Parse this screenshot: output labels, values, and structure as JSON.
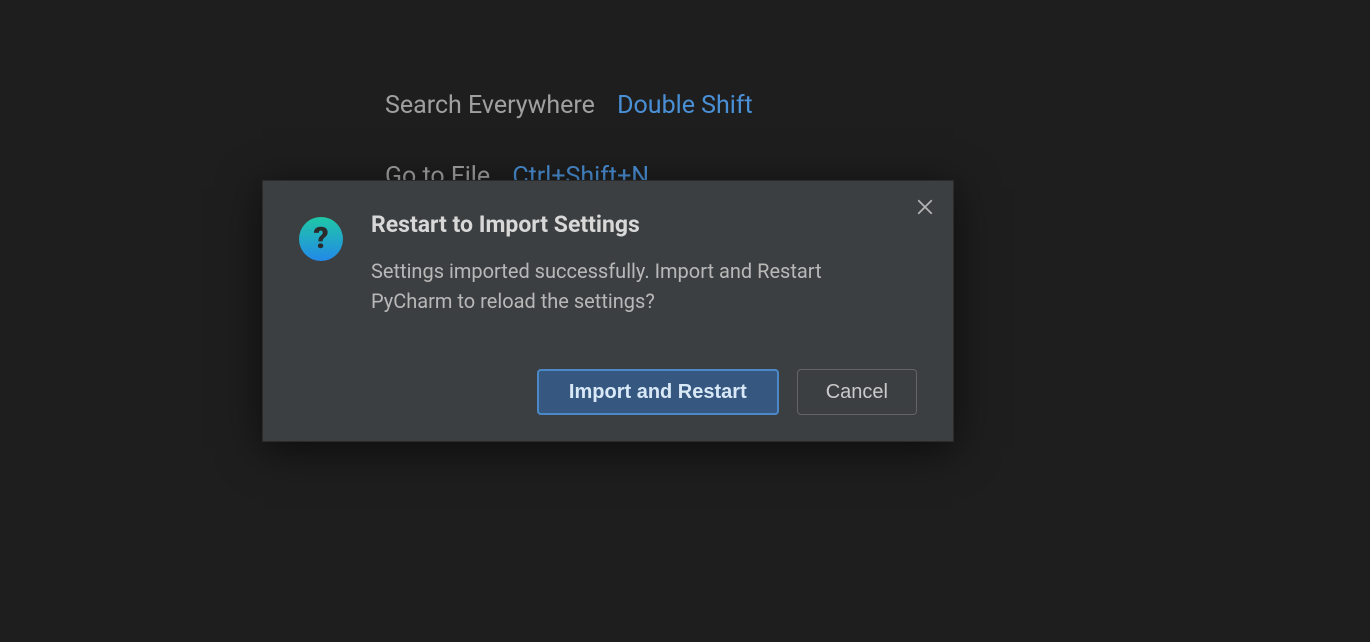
{
  "background": {
    "hints": [
      {
        "label": "Search Everywhere",
        "shortcut": "Double Shift"
      },
      {
        "label": "Go to File",
        "shortcut": "Ctrl+Shift+N"
      }
    ]
  },
  "dialog": {
    "title": "Restart to Import Settings",
    "message": "Settings imported successfully. Import and Restart PyCharm to reload the settings?",
    "icon_glyph": "?",
    "buttons": {
      "primary": "Import and Restart",
      "secondary": "Cancel"
    }
  }
}
